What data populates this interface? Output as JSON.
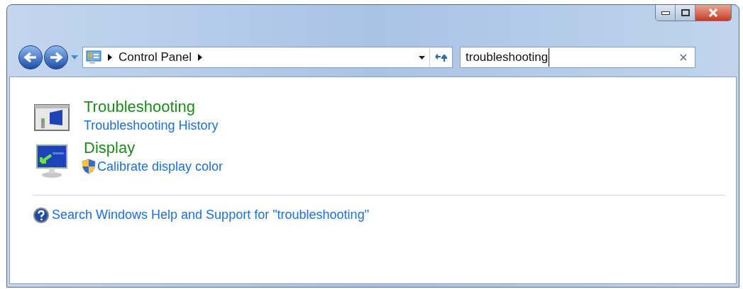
{
  "address_bar": {
    "breadcrumbs": [
      "Control Panel"
    ]
  },
  "search": {
    "value": "troubleshooting"
  },
  "results": [
    {
      "kind": "troubleshooting",
      "title": "Troubleshooting",
      "links": [
        {
          "label": "Troubleshooting History",
          "admin": false
        }
      ]
    },
    {
      "kind": "display",
      "title": "Display",
      "links": [
        {
          "label": "Calibrate display color",
          "admin": true
        }
      ]
    }
  ],
  "help_link": "Search Windows Help and Support for \"troubleshooting\""
}
